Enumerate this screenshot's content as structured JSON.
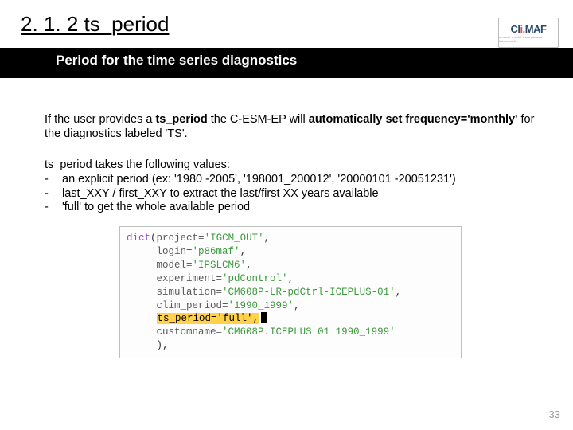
{
  "header": {
    "title": "2. 1. 2 ts_period",
    "subtitle": "Period for the time series diagnostics",
    "logo_main_a": "Cl",
    "logo_main_i": "i.",
    "logo_main_b": "MAF",
    "logo_sub": "climate model assessment framework"
  },
  "body": {
    "para1_a": "If the user provides a ",
    "para1_b": "ts_period",
    "para1_c": " the C-ESM-EP will ",
    "para1_d": "automatically set frequency='monthly'",
    "para1_e": " for the diagnostics labeled 'TS'.",
    "values_intro": "ts_period takes the following values:",
    "b1": "an explicit period (ex: '1980 -2005', '198001_200012', '20000101 -20051231')",
    "b2": "last_XXY / first_XXY to extract the last/first XX years available",
    "b3": "'full' to get the whole available period"
  },
  "code": {
    "dict": "dict",
    "op": "(",
    "l1k": "project",
    "l1v": "'IGCM_OUT'",
    "l2k": "login",
    "l2v": "'p86maf'",
    "l3k": "model",
    "l3v": "'IPSLCM6'",
    "l4k": "experiment",
    "l4v": "'pdControl'",
    "l5k": "simulation",
    "l5v": "'CM608P-LR-pdCtrl-ICEPLUS-01'",
    "l6k": "clim_period",
    "l6v": "'1990_1999'",
    "l7": "ts_period='full',",
    "l8k": "customname",
    "l8v": "'CM608P.ICEPLUS 01 1990_1999'",
    "cp": "),",
    "comma": ",",
    "eq": "="
  },
  "page": "33"
}
